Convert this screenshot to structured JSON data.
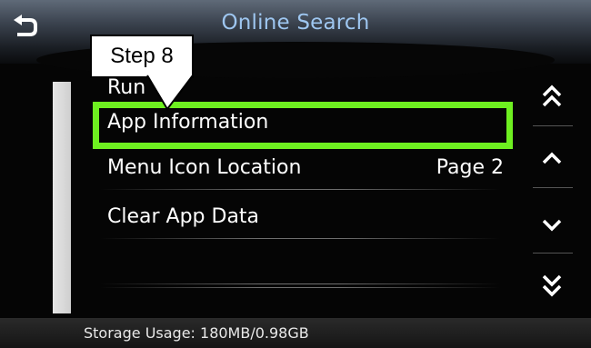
{
  "header": {
    "title": "Online Search",
    "back_icon": "back-arrow-icon"
  },
  "callout": {
    "label": "Step 8"
  },
  "list": {
    "items": [
      {
        "label": "Run",
        "value": ""
      },
      {
        "label": "App Information",
        "value": ""
      },
      {
        "label": "Menu Icon Location",
        "value": "Page 2"
      },
      {
        "label": "Clear App Data",
        "value": ""
      }
    ],
    "highlighted_item": "App Information"
  },
  "nav": {
    "buttons": [
      "page-up-icon",
      "scroll-up-icon",
      "scroll-down-icon",
      "page-down-icon"
    ]
  },
  "footer": {
    "storage": "Storage Usage: 180MB/0.98GB"
  },
  "colors": {
    "highlight": "#6ef020",
    "title": "#9ec6f0"
  }
}
